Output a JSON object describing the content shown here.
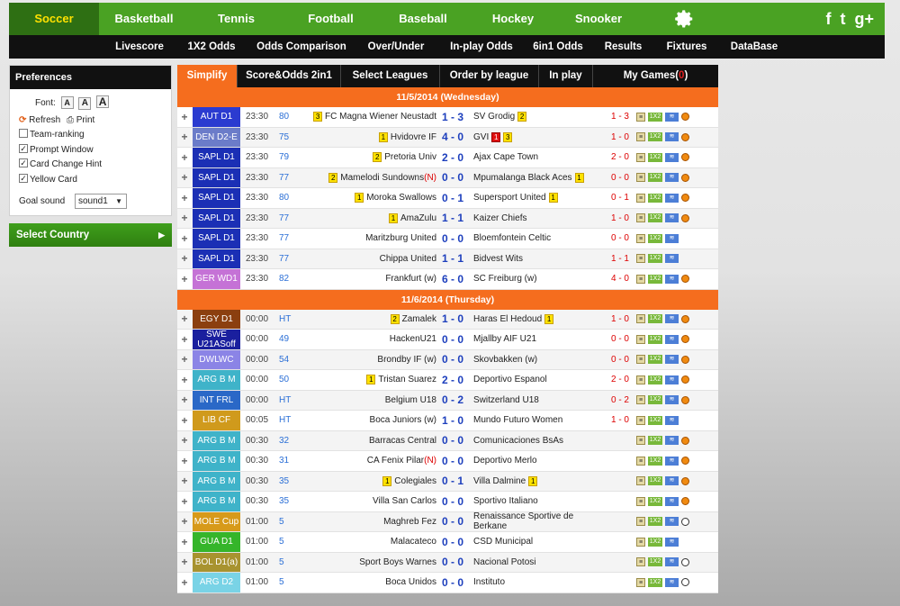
{
  "nav": {
    "sports": [
      "Soccer",
      "Basketball",
      "Tennis",
      "Football",
      "Baseball",
      "Hockey",
      "Snooker"
    ],
    "active": "Soccer",
    "settings_icon": "gear-icon",
    "social": [
      {
        "icon": "facebook-icon",
        "glyph": "f"
      },
      {
        "icon": "twitter-icon",
        "glyph": "t"
      },
      {
        "icon": "googleplus-icon",
        "glyph": "g+"
      }
    ]
  },
  "subnav": [
    "Livescore",
    "1X2 Odds",
    "Odds Comparison",
    "Over/Under",
    "In-play Odds",
    "6in1 Odds",
    "Results",
    "Fixtures",
    "DataBase"
  ],
  "prefs": {
    "title": "Preferences",
    "font_label": "Font:",
    "font_sizes": [
      "A",
      "A",
      "A"
    ],
    "refresh": "Refresh",
    "print": "Print",
    "options": [
      {
        "label": "Team-ranking",
        "checked": false
      },
      {
        "label": "Prompt Window",
        "checked": true
      },
      {
        "label": "Card Change Hint",
        "checked": true
      },
      {
        "label": "Yellow Card",
        "checked": true
      }
    ],
    "sound_label": "Goal sound",
    "sound_value": "sound1"
  },
  "select_country": "Select Country",
  "tabs": [
    "Simplify",
    "Score&Odds 2in1",
    "Select Leagues",
    "Order by league",
    "In play",
    "My Games(0)"
  ],
  "colors": {
    "accent": "#f56d1e",
    "nav_green": "#4aa223"
  },
  "groups": [
    {
      "date": "11/5/2014 (Wednesday)",
      "matches": [
        {
          "league": "AUT D1",
          "color": "#2b3bd0",
          "time": "23:30",
          "status": "80",
          "home": "FC Magna Wiener Neustadt",
          "home_card": "3",
          "score": "1 - 3",
          "away": "SV Grodig",
          "away_card": "2",
          "ht": "1 - 3",
          "ball": true
        },
        {
          "league": "DEN D2-E",
          "color": "#6b7cc9",
          "time": "23:30",
          "status": "75",
          "home": "Hvidovre IF",
          "home_card": "1",
          "score": "4 - 0",
          "away": "GVI",
          "away_red": "1",
          "away_card": "3",
          "ht": "1 - 0",
          "ball": true
        },
        {
          "league": "SAPL D1",
          "color": "#1b2fb5",
          "time": "23:30",
          "status": "79",
          "home": "Pretoria Univ",
          "home_card": "2",
          "score": "2 - 0",
          "away": "Ajax Cape Town",
          "ht": "2 - 0",
          "ball": true
        },
        {
          "league": "SAPL D1",
          "color": "#1b2fb5",
          "time": "23:30",
          "status": "77",
          "home": "Mamelodi Sundowns",
          "home_card": "2",
          "home_n": "(N)",
          "score": "0 - 0",
          "away": "Mpumalanga Black Aces",
          "away_card": "1",
          "ht": "0 - 0",
          "ball": true
        },
        {
          "league": "SAPL D1",
          "color": "#1b2fb5",
          "time": "23:30",
          "status": "80",
          "home": "Moroka Swallows",
          "home_card": "1",
          "score": "0 - 1",
          "away": "Supersport United",
          "away_card": "1",
          "ht": "0 - 1",
          "ball": true
        },
        {
          "league": "SAPL D1",
          "color": "#1b2fb5",
          "time": "23:30",
          "status": "77",
          "home": "AmaZulu",
          "home_card": "1",
          "score": "1 - 1",
          "away": "Kaizer Chiefs",
          "ht": "1 - 0",
          "ball": true
        },
        {
          "league": "SAPL D1",
          "color": "#1b2fb5",
          "time": "23:30",
          "status": "77",
          "home": "Maritzburg United",
          "score": "0 - 0",
          "away": "Bloemfontein Celtic",
          "ht": "0 - 0",
          "ball": false
        },
        {
          "league": "SAPL D1",
          "color": "#1b2fb5",
          "time": "23:30",
          "status": "77",
          "home": "Chippa United",
          "score": "1 - 1",
          "away": "Bidvest Wits",
          "ht": "1 - 1",
          "ball": false
        },
        {
          "league": "GER WD1",
          "color": "#c572d6",
          "time": "23:30",
          "status": "82",
          "home": "Frankfurt (w)",
          "score": "6 - 0",
          "away": "SC Freiburg (w)",
          "ht": "4 - 0",
          "ball": true
        }
      ]
    },
    {
      "date": "11/6/2014 (Thursday)",
      "matches": [
        {
          "league": "EGY D1",
          "color": "#8b3f0f",
          "time": "00:00",
          "status": "HT",
          "home": "Zamalek",
          "home_card": "2",
          "score": "1 - 0",
          "away": "Haras El Hedoud",
          "away_card": "1",
          "ht": "1 - 0",
          "ball": true
        },
        {
          "league": "SWE U21ASoff",
          "color": "#1a1f9e",
          "time": "00:00",
          "status": "49",
          "home": "HackenU21",
          "score": "0 - 0",
          "away": "Mjallby AIF U21",
          "ht": "0 - 0",
          "ball": true
        },
        {
          "league": "DWLWC",
          "color": "#8b84e6",
          "time": "00:00",
          "status": "54",
          "home": "Brondby IF (w)",
          "score": "0 - 0",
          "away": "Skovbakken (w)",
          "ht": "0 - 0",
          "ball": true
        },
        {
          "league": "ARG B M",
          "color": "#3fb3c9",
          "time": "00:00",
          "status": "50",
          "home": "Tristan Suarez",
          "home_card": "1",
          "score": "2 - 0",
          "away": "Deportivo Espanol",
          "ht": "2 - 0",
          "ball": true
        },
        {
          "league": "INT FRL",
          "color": "#2a68c7",
          "time": "00:00",
          "status": "HT",
          "home": "Belgium U18",
          "score": "0 - 2",
          "away": "Switzerland U18",
          "ht": "0 - 2",
          "ball": true
        },
        {
          "league": "LIB CF",
          "color": "#d09a1c",
          "time": "00:05",
          "status": "HT",
          "home": "Boca Juniors (w)",
          "score": "1 - 0",
          "away": "Mundo Futuro Women",
          "ht": "1 - 0",
          "ball": false
        },
        {
          "league": "ARG B M",
          "color": "#3fb3c9",
          "time": "00:30",
          "status": "32",
          "home": "Barracas Central",
          "score": "0 - 0",
          "away": "Comunicaciones BsAs",
          "ht": "",
          "ball": true
        },
        {
          "league": "ARG B M",
          "color": "#3fb3c9",
          "time": "00:30",
          "status": "31",
          "home": "CA Fenix Pilar",
          "home_n": "(N)",
          "score": "0 - 0",
          "away": "Deportivo Merlo",
          "ht": "",
          "ball": true
        },
        {
          "league": "ARG B M",
          "color": "#3fb3c9",
          "time": "00:30",
          "status": "35",
          "home": "Colegiales",
          "home_card": "1",
          "score": "0 - 1",
          "away": "Villa Dalmine",
          "away_card": "1",
          "ht": "",
          "ball": true
        },
        {
          "league": "ARG B M",
          "color": "#3fb3c9",
          "time": "00:30",
          "status": "35",
          "home": "Villa San Carlos",
          "score": "0 - 0",
          "away": "Sportivo Italiano",
          "ht": "",
          "ball": true
        },
        {
          "league": "MOLE Cup",
          "color": "#d79a1a",
          "time": "01:00",
          "status": "5",
          "home": "Maghreb Fez",
          "score": "0 - 0",
          "away": "Renaissance Sportive de Berkane",
          "ht": "",
          "ball": true,
          "ball_white": true
        },
        {
          "league": "GUA D1",
          "color": "#35b52a",
          "time": "01:00",
          "status": "5",
          "home": "Malacateco",
          "score": "0 - 0",
          "away": "CSD Municipal",
          "ht": "",
          "ball": false
        },
        {
          "league": "BOL D1(a)",
          "color": "#a8932f",
          "time": "01:00",
          "status": "5",
          "home": "Sport Boys Warnes",
          "score": "0 - 0",
          "away": "Nacional Potosi",
          "ht": "",
          "ball": true,
          "ball_white": true
        },
        {
          "league": "ARG D2",
          "color": "#79d3e6",
          "time": "01:00",
          "status": "5",
          "home": "Boca Unidos",
          "score": "0 - 0",
          "away": "Instituto",
          "ht": "",
          "ball": true,
          "ball_white": true
        }
      ]
    }
  ]
}
